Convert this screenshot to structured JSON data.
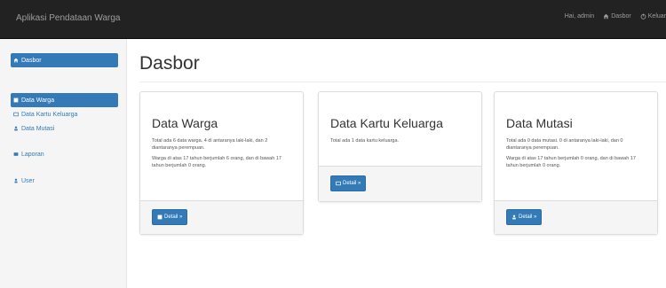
{
  "navbar": {
    "brand": "Aplikasi Pendataan Warga",
    "user_label": "Hai, admin",
    "dasbor_label": "Dasbor",
    "logout_label": "Keluar"
  },
  "sidebar": {
    "items": [
      {
        "label": "Dasbor",
        "icon": "home-icon",
        "active": true
      },
      {
        "label": "Data Warga",
        "icon": "list-icon",
        "active": true
      },
      {
        "label": "Data Kartu Keluarga",
        "icon": "id-card-icon",
        "active": false
      },
      {
        "label": "Data Mutasi",
        "icon": "users-icon",
        "active": false
      },
      {
        "label": "Laporan",
        "icon": "report-icon",
        "active": false
      },
      {
        "label": "User",
        "icon": "user-icon",
        "active": false
      }
    ]
  },
  "main": {
    "title": "Dasbor",
    "cards": [
      {
        "title": "Data Warga",
        "text1": "Total ada 6 data warga. 4 di antaranya laki-laki, dan 2 diantaranya perempuan.",
        "text2": "Warga di atas 17 tahun berjumlah 6 orang, dan di bawah 17 tahun berjumlah 0 orang.",
        "button": "Detail »"
      },
      {
        "title": "Data Kartu Keluarga",
        "text1": "Total ada 1 data kartu keluarga.",
        "button": "Detail »"
      },
      {
        "title": "Data Mutasi",
        "text1": "Total ada 0 data mutasi. 0 di antaranya laki-laki, dan 0 diantaranya perempuan.",
        "text2": "Warga di atas 17 tahun berjumlah 0 orang, dan di bawah 17 tahun berjumlah 0 orang.",
        "button": "Detail »"
      }
    ]
  },
  "colors": {
    "navbar_bg": "#222222",
    "primary": "#337ab7",
    "sidebar_bg": "#f5f5f5"
  }
}
